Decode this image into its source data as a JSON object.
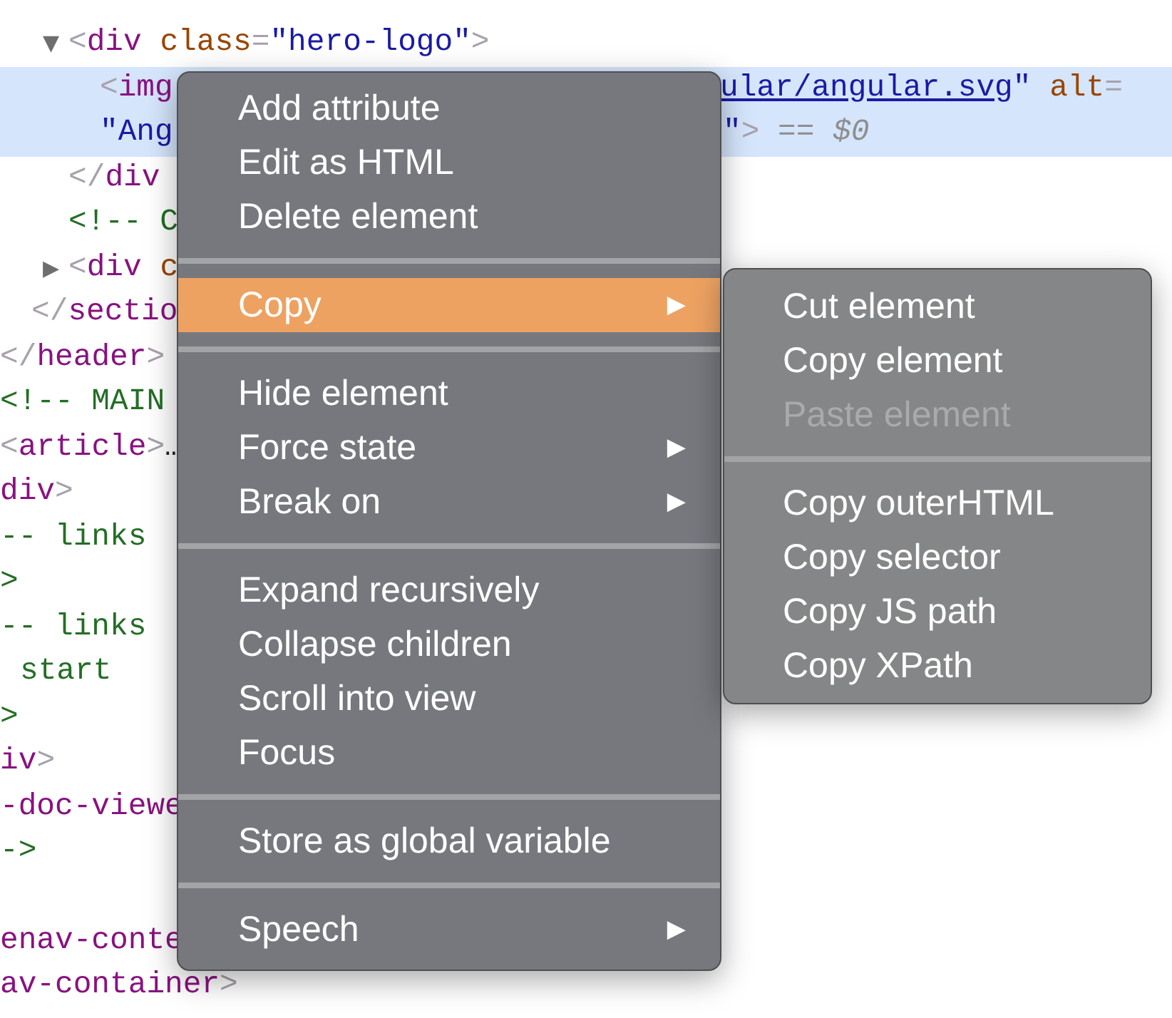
{
  "code": {
    "lines": [
      {
        "selected": false,
        "toggle": "▼",
        "segments": [
          [
            {
              "kind": "punct",
              "text": "<"
            },
            {
              "kind": "tag",
              "text": "div"
            },
            {
              "kind": "attr",
              "text": "class"
            },
            {
              "kind": "punct",
              "text": "="
            },
            {
              "kind": "value",
              "text": "\"hero-logo\""
            },
            {
              "kind": "punct",
              "text": ">"
            }
          ]
        ]
      },
      {
        "selected": true,
        "segments": [
          [
            {
              "kind": "punct",
              "text": "<"
            },
            {
              "kind": "tag",
              "text": "img"
            }
          ],
          [
            {
              "kind": "link",
              "text": "ular/angular.svg"
            },
            {
              "kind": "value",
              "text": "\""
            },
            {
              "kind": "attr",
              "text": "alt"
            },
            {
              "kind": "punct",
              "text": "="
            }
          ]
        ]
      },
      {
        "selected": true,
        "segments": [
          [
            {
              "kind": "value",
              "text": "\"Ang"
            }
          ],
          [
            {
              "kind": "value",
              "text": "\""
            },
            {
              "kind": "punct",
              "text": ">"
            },
            {
              "kind": "marker",
              "text": " == $0"
            }
          ]
        ]
      },
      {
        "selected": false,
        "segments": [
          [
            {
              "kind": "punct",
              "text": "</"
            },
            {
              "kind": "tag",
              "text": "div"
            }
          ]
        ]
      },
      {
        "selected": false,
        "segments": [
          [
            {
              "kind": "comment",
              "text": "<!-- C"
            }
          ]
        ]
      },
      {
        "selected": false,
        "toggle": "▶",
        "segments": [
          [
            {
              "kind": "punct",
              "text": "<"
            },
            {
              "kind": "tag",
              "text": "div"
            },
            {
              "kind": "attr",
              "text": "c"
            }
          ]
        ]
      },
      {
        "selected": false,
        "segments": [
          [
            {
              "kind": "punct",
              "text": "</"
            },
            {
              "kind": "tag",
              "text": "sectio"
            }
          ]
        ]
      },
      {
        "selected": false,
        "segments": [
          [
            {
              "kind": "punct",
              "text": "</"
            },
            {
              "kind": "tag",
              "text": "header"
            },
            {
              "kind": "punct",
              "text": ">"
            }
          ]
        ]
      },
      {
        "selected": false,
        "segments": [
          [
            {
              "kind": "comment",
              "text": "<!-- MAIN"
            }
          ]
        ]
      },
      {
        "selected": false,
        "segments": [
          [
            {
              "kind": "punct",
              "text": "<"
            },
            {
              "kind": "tag",
              "text": "article"
            },
            {
              "kind": "punct",
              "text": ">"
            },
            {
              "kind": "text",
              "text": "…"
            }
          ]
        ]
      },
      {
        "selected": false,
        "segments": [
          [
            {
              "kind": "tag",
              "text": "div"
            },
            {
              "kind": "punct",
              "text": ">"
            }
          ]
        ]
      },
      {
        "selected": false,
        "segments": [
          [
            {
              "kind": "comment",
              "text": "-- links"
            }
          ]
        ]
      },
      {
        "selected": false,
        "segments": [
          [
            {
              "kind": "comment",
              "text": ">"
            }
          ]
        ]
      },
      {
        "selected": false,
        "segments": [
          [
            {
              "kind": "comment",
              "text": "-- links"
            }
          ]
        ]
      },
      {
        "selected": false,
        "segments": [
          [
            {
              "kind": "comment",
              "text": "start"
            }
          ]
        ]
      },
      {
        "selected": false,
        "segments": [
          [
            {
              "kind": "comment",
              "text": ">"
            }
          ]
        ]
      },
      {
        "selected": false,
        "segments": [
          [
            {
              "kind": "tag",
              "text": "iv"
            },
            {
              "kind": "punct",
              "text": ">"
            }
          ]
        ]
      },
      {
        "selected": false,
        "segments": [
          [
            {
              "kind": "tag",
              "text": "-doc-viewe"
            }
          ]
        ]
      },
      {
        "selected": false,
        "segments": [
          [
            {
              "kind": "comment",
              "text": "->"
            }
          ]
        ]
      },
      {
        "selected": false,
        "segments": [
          [
            {
              "kind": "tag",
              "text": "enav-conte"
            }
          ]
        ]
      },
      {
        "selected": false,
        "segments": [
          [
            {
              "kind": "tag",
              "text": "av-container"
            },
            {
              "kind": "punct",
              "text": ">"
            }
          ]
        ]
      }
    ]
  },
  "context_menu": {
    "groups": [
      {
        "items": [
          {
            "label": "Add attribute",
            "selected": false
          },
          {
            "label": "Edit as HTML",
            "selected": false
          },
          {
            "label": "Delete element",
            "selected": false
          }
        ]
      },
      {
        "items": [
          {
            "label": "Copy",
            "selected": true,
            "arrow": "▶"
          }
        ]
      },
      {
        "items": [
          {
            "label": "Hide element",
            "selected": false
          },
          {
            "label": "Force state",
            "selected": false,
            "arrow": "▶"
          },
          {
            "label": "Break on",
            "selected": false,
            "arrow": "▶"
          }
        ]
      },
      {
        "items": [
          {
            "label": "Expand recursively",
            "selected": false
          },
          {
            "label": "Collapse children",
            "selected": false
          },
          {
            "label": "Scroll into view",
            "selected": false
          },
          {
            "label": "Focus",
            "selected": false
          }
        ]
      },
      {
        "items": [
          {
            "label": "Store as global variable",
            "selected": false
          }
        ]
      },
      {
        "items": [
          {
            "label": "Speech",
            "selected": false,
            "arrow": "▶"
          }
        ]
      }
    ]
  },
  "submenu": {
    "groups": [
      {
        "items": [
          {
            "label": "Cut element",
            "disabled": false
          },
          {
            "label": "Copy element",
            "disabled": false
          },
          {
            "label": "Paste element",
            "disabled": true
          }
        ]
      },
      {
        "items": [
          {
            "label": "Copy outerHTML",
            "disabled": false
          },
          {
            "label": "Copy selector",
            "disabled": false
          },
          {
            "label": "Copy JS path",
            "disabled": false
          },
          {
            "label": "Copy XPath",
            "disabled": false
          }
        ]
      }
    ]
  }
}
